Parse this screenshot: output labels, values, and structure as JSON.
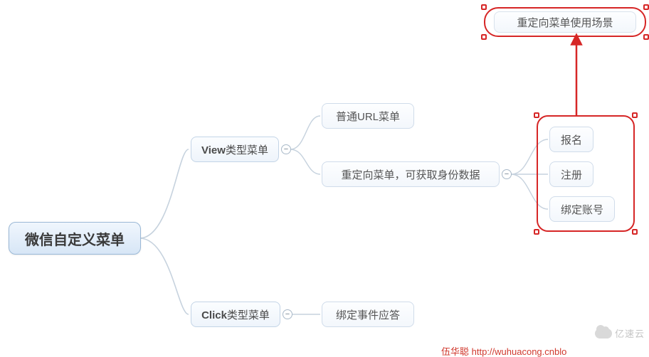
{
  "root": {
    "label": "微信自定义菜单"
  },
  "branches": {
    "view": {
      "label_prefix": "View",
      "label_suffix": "类型菜单"
    },
    "click": {
      "label_prefix": "Click",
      "label_suffix": "类型菜单"
    }
  },
  "view_children": {
    "normal": {
      "label": "普通URL菜单"
    },
    "redirect": {
      "label": "重定向菜单，可获取身份数据"
    }
  },
  "redirect_children": {
    "signup": {
      "label": "报名"
    },
    "register": {
      "label": "注册"
    },
    "bind": {
      "label": "绑定账号"
    }
  },
  "click_children": {
    "event": {
      "label": "绑定事件应答"
    }
  },
  "callouts": {
    "redirect_scene": {
      "label": "重定向菜单使用场景"
    }
  },
  "attribution": {
    "name": "伍华聪",
    "url_text": "http://wuhuacong.cnblo"
  },
  "watermark": {
    "text": "亿速云"
  }
}
